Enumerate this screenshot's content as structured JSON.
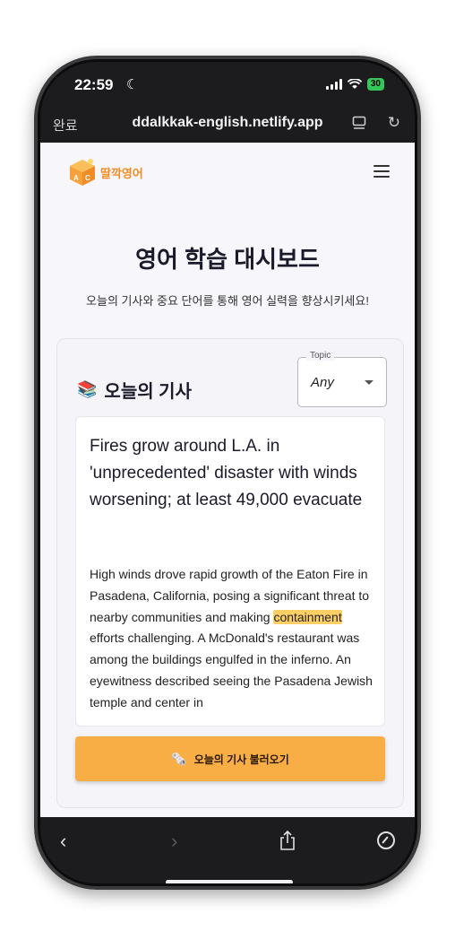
{
  "status": {
    "time": "22:59",
    "battery": "30"
  },
  "browser": {
    "done_label": "완료",
    "url": "ddalkkak-english.netlify.app"
  },
  "brand": {
    "name": "딸깍영어"
  },
  "page": {
    "title": "영어 학습 대시보드",
    "subtitle": "오늘의 기사와 중요 단어를 통해 영어 실력을 향상시키세요!"
  },
  "card": {
    "label": "오늘의 기사",
    "topic": {
      "legend": "Topic",
      "value": "Any"
    },
    "article": {
      "headline": "Fires grow around L.A. in 'unprecedented' disaster with winds worsening; at least 49,000 evacuate",
      "body_before": "High winds drove rapid growth of the Eaton Fire in Pasadena, California, posing a significant threat to nearby communities and making ",
      "highlight": "containment",
      "body_after": " efforts challenging. A McDonald's restaurant was among the buildings engulfed in the inferno. An eyewitness described seeing the Pasadena Jewish temple and center in"
    },
    "button_label": "오늘의 기사 불러오기"
  },
  "colors": {
    "accent": "#f9ad45",
    "highlight": "#ffcf66",
    "brand": "#f08c25"
  },
  "icons": [
    "moon-icon",
    "signal-icon",
    "wifi-icon",
    "battery-icon",
    "reader-icon",
    "reload-icon",
    "logo-icon",
    "hamburger-menu-icon",
    "books-icon",
    "chevron-down-icon",
    "newspaper-icon",
    "back-icon",
    "forward-icon",
    "share-icon",
    "compass-icon"
  ]
}
